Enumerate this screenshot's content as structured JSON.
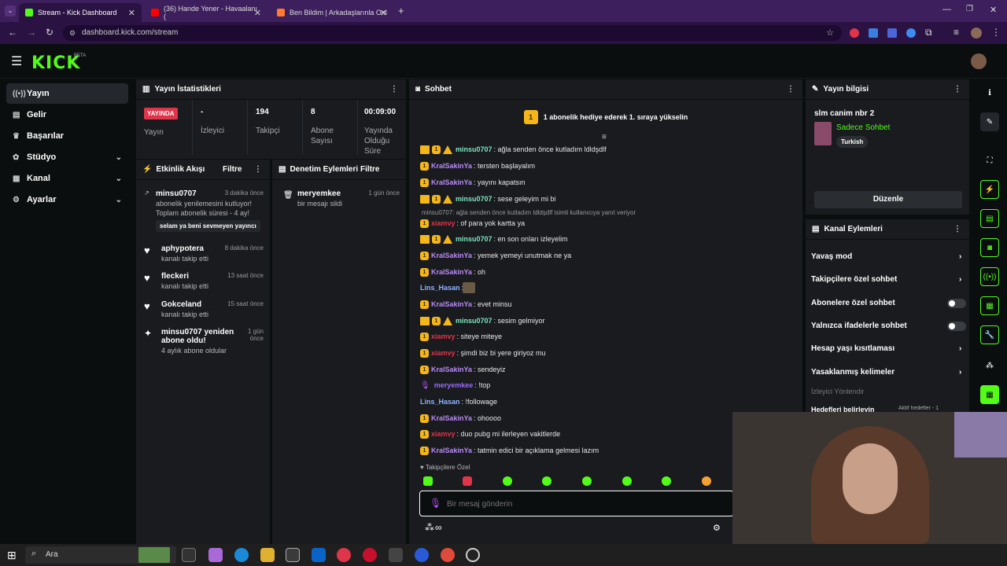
{
  "browser": {
    "tabs": [
      {
        "title": "Stream - Kick Dashboard"
      },
      {
        "title": "(36) Hande Yener - Havaalanı ("
      },
      {
        "title": "Ben Bildim | Arkadaşlarınla Onl"
      }
    ],
    "url": "dashboard.kick.com/stream"
  },
  "logo": "KICK",
  "logo_badge": "BETA",
  "nav": [
    {
      "label": "Yayın"
    },
    {
      "label": "Gelir"
    },
    {
      "label": "Başarılar"
    },
    {
      "label": "Stüdyo"
    },
    {
      "label": "Kanal"
    },
    {
      "label": "Ayarlar"
    }
  ],
  "stats": {
    "title": "Yayın İstatistikleri",
    "live": "YAYINDA",
    "live_label": "Yayın",
    "items": [
      {
        "value": "-",
        "label": "İzleyici"
      },
      {
        "value": "194",
        "label": "Takipçi"
      },
      {
        "value": "8",
        "label": "Abone Sayısı"
      },
      {
        "value": "00:09:00",
        "label": "Yayında Olduğu Süre"
      }
    ]
  },
  "activity": {
    "title": "Etkinlik Akışı",
    "filter": "Filtre",
    "items": [
      {
        "name": "minsu0707",
        "time": "3 dakika önce",
        "desc": "abonelik yenilemesini kutluyor!",
        "desc2": "Toplam abonelik süresi - 4 ay!",
        "quote": "selam ya beni sevmeyen yayıncı"
      },
      {
        "name": "aphypotera",
        "time": "8 dakika önce",
        "desc": "kanalı takip etti"
      },
      {
        "name": "fleckeri",
        "time": "13 saat önce",
        "desc": "kanalı takip etti"
      },
      {
        "name": "Gokceland",
        "time": "15 saat önce",
        "desc": "kanalı takip etti"
      },
      {
        "name": "minsu0707 yeniden abone oldu!",
        "time": "1 gün önce",
        "desc": "4 aylık abone oldular"
      }
    ]
  },
  "moderation": {
    "title": "Denetim Eylemleri",
    "filter": "Filtre",
    "items": [
      {
        "name": "meryemkee",
        "desc": "bir mesajı sildi",
        "time": "1 gün önce"
      }
    ]
  },
  "chat": {
    "title": "Sohbet",
    "banner": "1 abonelik hediye ederek 1. sıraya yükselin",
    "reply_note": "minsu0707: ağla senden önce kutladım ldldşdlf isimli kullanıcıya yanıt veriyor",
    "messages": [
      {
        "user": "minsu0707",
        "text": ": ağla senden önce kutladım ldldşdlf",
        "color": "#7fe6c0",
        "badges": "cbw"
      },
      {
        "user": "KralSakinYa",
        "text": ": tersten başlayalım",
        "color": "#b98af5",
        "badges": "b"
      },
      {
        "user": "KralSakinYa",
        "text": ": yayını kapatsın",
        "color": "#b98af5",
        "badges": "b"
      },
      {
        "user": "minsu0707",
        "text": ": sese geleyim mi bi",
        "color": "#7fe6c0",
        "badges": "cbw"
      },
      {
        "user": "xiamvy",
        "text": ": of para yok kartta ya",
        "color": "#e0344b",
        "badges": "b"
      },
      {
        "user": "minsu0707",
        "text": ": en son onları izleyelim",
        "color": "#7fe6c0",
        "badges": "cbw"
      },
      {
        "user": "KralSakinYa",
        "text": ": yemek yemeyi unutmak ne ya",
        "color": "#b98af5",
        "badges": "b"
      },
      {
        "user": "KralSakinYa",
        "text": ": oh",
        "color": "#b98af5",
        "badges": "b"
      },
      {
        "user": "Lins_Hasan",
        "text": ":",
        "color": "#8fb3ff",
        "badges": ""
      },
      {
        "user": "KralSakinYa",
        "text": ": evet minsu",
        "color": "#b98af5",
        "badges": "b"
      },
      {
        "user": "minsu0707",
        "text": ": sesim gelmiyor",
        "color": "#7fe6c0",
        "badges": "cbw"
      },
      {
        "user": "xiamvy",
        "text": ": siteye miteye",
        "color": "#e0344b",
        "badges": "b"
      },
      {
        "user": "xiamvy",
        "text": ": şimdi biz bi yere giriyoz mu",
        "color": "#e0344b",
        "badges": "b"
      },
      {
        "user": "KralSakinYa",
        "text": ": sendeyiz",
        "color": "#b98af5",
        "badges": "b"
      },
      {
        "user": "meryemkee",
        "text": ": !top",
        "color": "#9a6bff",
        "badges": "m"
      },
      {
        "user": "Lins_Hasan",
        "text": ": !followage",
        "color": "#8fb3ff",
        "badges": ""
      },
      {
        "user": "KralSakinYa",
        "text": ": ohoooo",
        "color": "#b98af5",
        "badges": "b"
      },
      {
        "user": "xiamvy",
        "text": ": duo pubg mi ilerleyen vakitlerde",
        "color": "#e0344b",
        "badges": "b"
      },
      {
        "user": "KralSakinYa",
        "text": ": tatmin edici bir açıklama gelmesi lazım",
        "color": "#b98af5",
        "badges": "b"
      }
    ],
    "followers_only": "Takipçilere Özel",
    "placeholder": "Bir mesaj gönderin",
    "infinity": "∞"
  },
  "stream_info": {
    "title": "Yayın bilgisi",
    "stream_title": "slm canim nbr 2",
    "category": "Sadece Sohbet",
    "tag": "Turkish",
    "edit": "Düzenle"
  },
  "channel_actions": {
    "title": "Kanal Eylemleri",
    "items": [
      {
        "label": "Yavaş mod",
        "kind": "chevron"
      },
      {
        "label": "Takipçilere özel sohbet",
        "kind": "chevron"
      },
      {
        "label": "Abonelere özel sohbet",
        "kind": "toggle"
      },
      {
        "label": "Yalnızca ifadelerle sohbet",
        "kind": "toggle"
      },
      {
        "label": "Hesap yaşı kısıtlaması",
        "kind": "chevron"
      },
      {
        "label": "Yasaklanmış kelimeler",
        "kind": "chevron"
      }
    ],
    "extra": "İzleyici Yönlendir",
    "partial": "Hedefleri belirleyin",
    "partial_tag": "Aktif hedefler - 1"
  },
  "taskbar": {
    "search": "Ara"
  },
  "colors": {
    "accent": "#53fc18",
    "live": "#e0344b",
    "badge": "#f5b619"
  }
}
